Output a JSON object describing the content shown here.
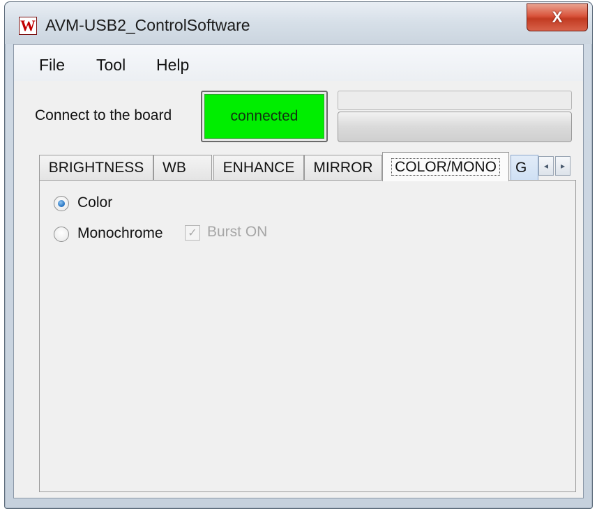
{
  "window": {
    "title": "AVM-USB2_ControlSoftware",
    "app_icon_glyph": "W",
    "close_glyph": "X"
  },
  "menu": {
    "items": [
      {
        "label": "File"
      },
      {
        "label": "Tool"
      },
      {
        "label": "Help"
      }
    ]
  },
  "connection": {
    "label": "Connect to the board",
    "status": "connected",
    "status_color": "#00ee00"
  },
  "tabs": {
    "items": [
      {
        "label": "BRIGHTNESS"
      },
      {
        "label": "WB"
      },
      {
        "label": "ENHANCE"
      },
      {
        "label": "MIRROR"
      },
      {
        "label": "COLOR/MONO"
      },
      {
        "label": "G"
      }
    ],
    "active": "COLOR/MONO",
    "scroll_left": "◂",
    "scroll_right": "▸"
  },
  "color_mono": {
    "color_option": {
      "label": "Color",
      "checked": true
    },
    "mono_option": {
      "label": "Monochrome",
      "checked": false
    },
    "burst": {
      "label": "Burst ON",
      "checked": true,
      "enabled": false,
      "check_glyph": "✓"
    }
  }
}
